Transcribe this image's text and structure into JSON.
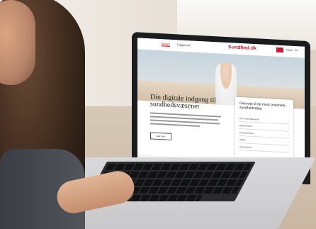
{
  "nav": {
    "tab_active": "Borger",
    "tab_other": "Fagperson",
    "brand": "Sundhed.dk",
    "right_links": [
      "Log ind",
      "Hjælp",
      "EN"
    ]
  },
  "hero": {
    "headline": "Din digitale indgang til sundhedsvæsenet"
  },
  "cta": {
    "label": "Læs mere"
  },
  "panel": {
    "title": "Genveje til de mest anvendte sundhedsdata",
    "rows": [
      "Min sundhedsjournal",
      "Medicinkortet",
      "Laboratoriesvar",
      "Aftaler",
      "Vaccinationer"
    ]
  }
}
